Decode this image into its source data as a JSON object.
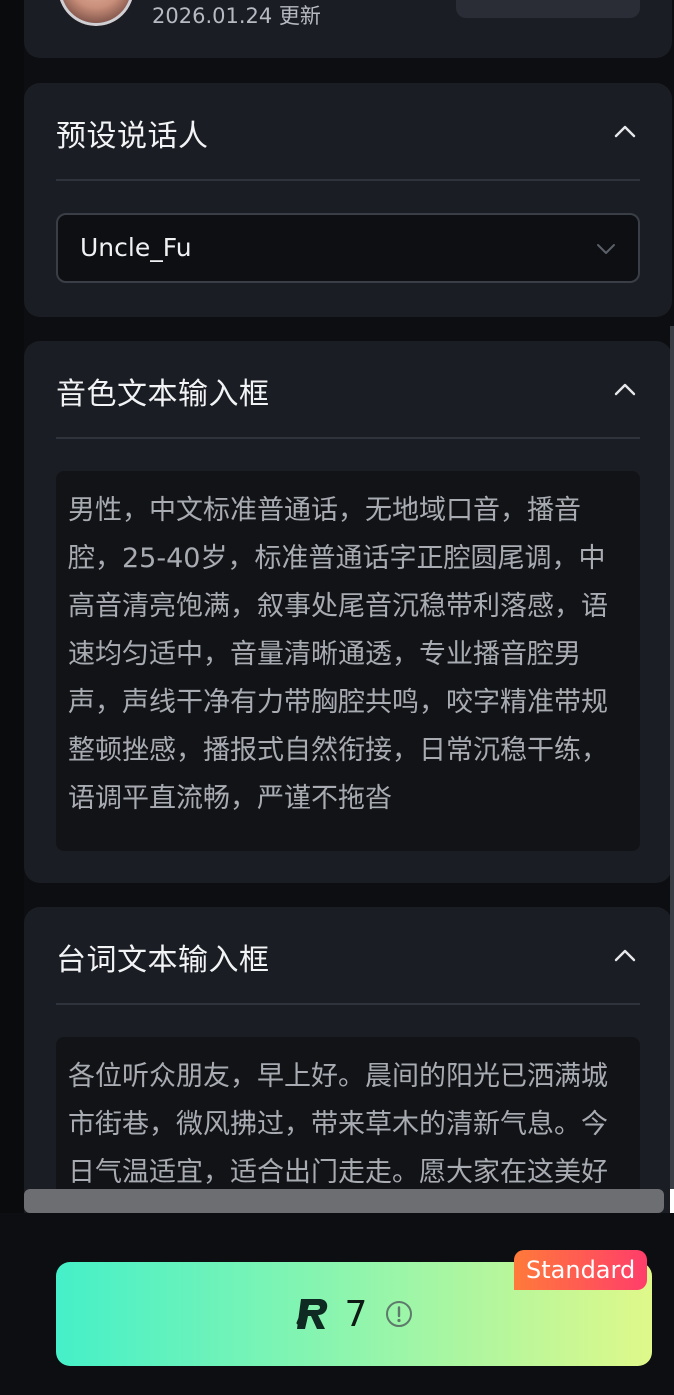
{
  "profile": {
    "updated_text": "2026.01.24 更新"
  },
  "preset_speaker": {
    "title": "预设说话人",
    "selected_value": "Uncle_Fu"
  },
  "timbre_input": {
    "title": "音色文本输入框",
    "text": "男性，中文标准普通话，无地域口音，播音腔，25-40岁，标准普通话字正腔圆尾调，中高音清亮饱满，叙事处尾音沉稳带利落感，语速均匀适中，音量清晰通透，专业播音腔男声，声线干净有力带胸腔共鸣，咬字精准带规整顿挫感，播报式自然衔接，日常沉稳干练，语调平直流畅，严谨不拖沓"
  },
  "script_input": {
    "title": "台词文本输入框",
    "text": "各位听众朋友，早上好。晨间的阳光已洒满城市街巷，微风拂过，带来草木的清新气息。今日气温适宜，适合出门走走。愿大家在这美好"
  },
  "generate": {
    "credits": "7",
    "badge": "Standard"
  },
  "icons": {
    "collapse": "chevron-up-icon",
    "dropdown": "chevron-down-icon",
    "logo": "r-logo-icon",
    "info": "info-icon"
  },
  "colors": {
    "card_bg": "#1a1d23",
    "page_bg": "#0d0e11",
    "button_gradient_start": "#45f0c8",
    "button_gradient_end": "#dff88a",
    "badge_start": "#ff7a3a",
    "badge_end": "#ff3d6a"
  }
}
